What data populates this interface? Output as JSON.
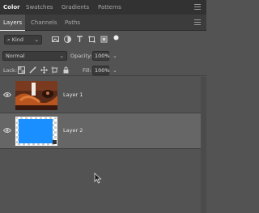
{
  "top_tabs": [
    "Color",
    "Swatches",
    "Gradients",
    "Patterns"
  ],
  "panel_tabs": [
    "Layers",
    "Channels",
    "Paths"
  ],
  "filter": {
    "kind_label": "Kind"
  },
  "blend": {
    "mode": "Normal",
    "opacity_label": "Opacity:",
    "opacity_value": "100%"
  },
  "lock": {
    "lock_label": "Lock:",
    "fill_label": "Fill:",
    "fill_value": "100%"
  },
  "layers": [
    {
      "name": "Layer 1",
      "visible": true,
      "selected": false
    },
    {
      "name": "Layer 2",
      "visible": true,
      "selected": true
    }
  ],
  "colors": {
    "layer2_fill": "#1a8fff",
    "selected_row": "#666666"
  }
}
